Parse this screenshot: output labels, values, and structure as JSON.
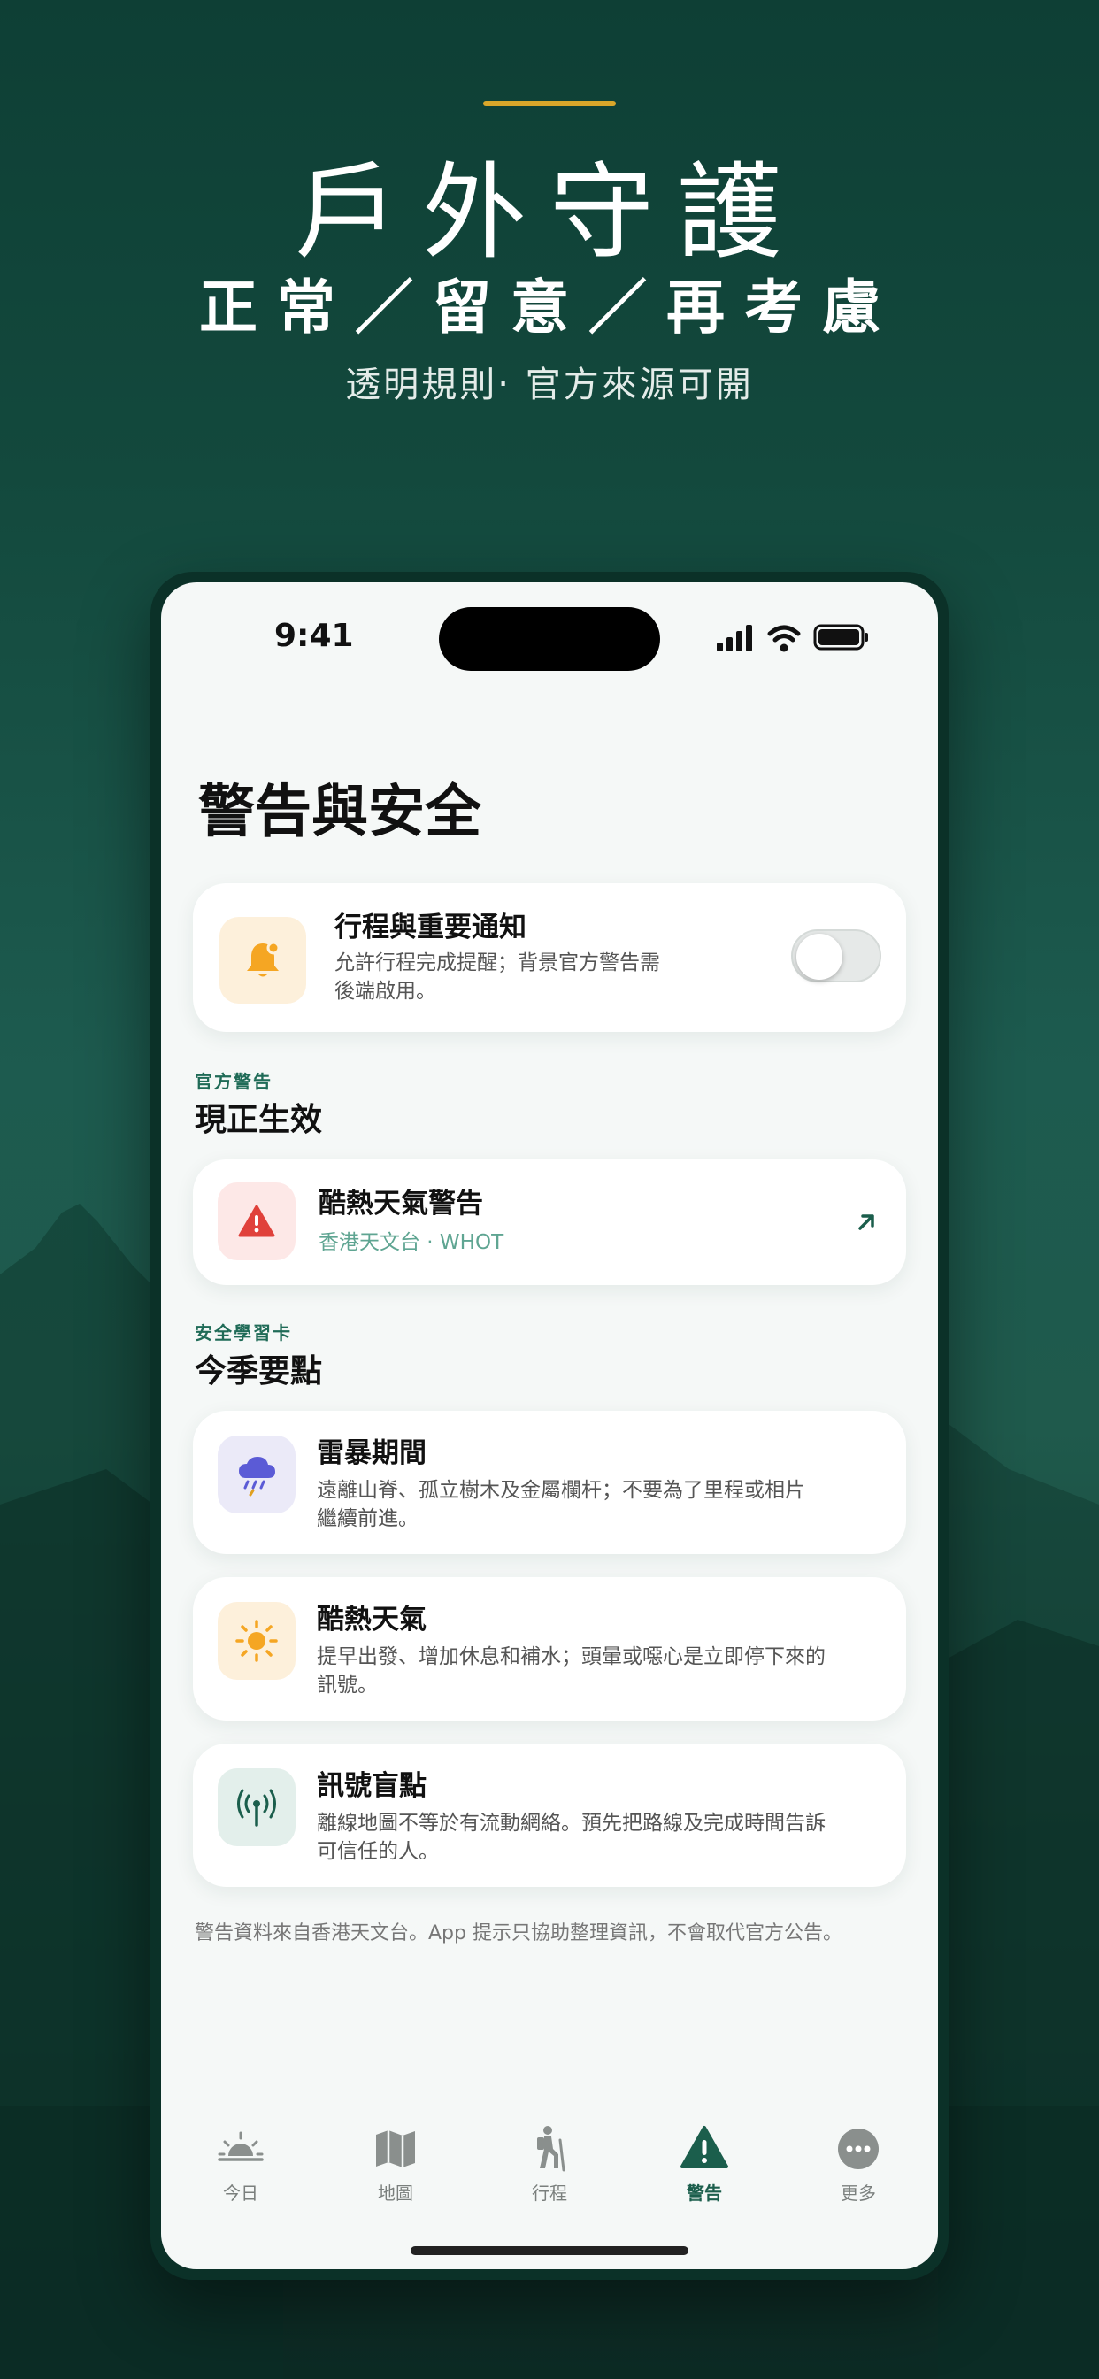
{
  "hero": {
    "title": "戶外守護",
    "subtitle": "正常／留意／再考慮",
    "tagline": "透明規則‧ 官方來源可開"
  },
  "status_bar": {
    "time": "9:41"
  },
  "page": {
    "title": "警告與安全"
  },
  "notification_card": {
    "title": "行程與重要通知",
    "desc_line1": "允許行程完成提醒；背景官方警告需",
    "desc_line2": "後端啟用。",
    "toggle_on": false
  },
  "official_section": {
    "kicker": "官方警告",
    "title": "現正生效"
  },
  "warning_card": {
    "title": "酷熱天氣警告",
    "source": "香港天文台 · WHOT"
  },
  "learning_section": {
    "kicker": "安全學習卡",
    "title": "今季要點"
  },
  "tips": [
    {
      "title": "雷暴期間",
      "line1": "遠離山脊、孤立樹木及金屬欄杆；不要為了里程或相片",
      "line2": "繼續前進。",
      "icon": "storm-cloud-icon"
    },
    {
      "title": "酷熱天氣",
      "line1": "提早出發、增加休息和補水；頭暈或噁心是立即停下來的",
      "line2": "訊號。",
      "icon": "sun-icon"
    },
    {
      "title": "訊號盲點",
      "line1": "離線地圖不等於有流動網絡。預先把路線及完成時間告訴",
      "line2": "可信任的人。",
      "icon": "antenna-icon"
    }
  ],
  "footer_note": "警告資料來自香港天文台。App 提示只協助整理資訊，不會取代官方公告。",
  "tabs": [
    {
      "label": "今日",
      "icon": "sunrise-icon",
      "active": false
    },
    {
      "label": "地圖",
      "icon": "map-icon",
      "active": false
    },
    {
      "label": "行程",
      "icon": "hiker-icon",
      "active": false
    },
    {
      "label": "警告",
      "icon": "warning-icon",
      "active": true
    },
    {
      "label": "更多",
      "icon": "more-icon",
      "active": false
    }
  ],
  "colors": {
    "accent": "#d9a62a",
    "brand_green": "#1b5e4c",
    "alert_red": "#e0413b",
    "bell_orange": "#f5a623"
  }
}
